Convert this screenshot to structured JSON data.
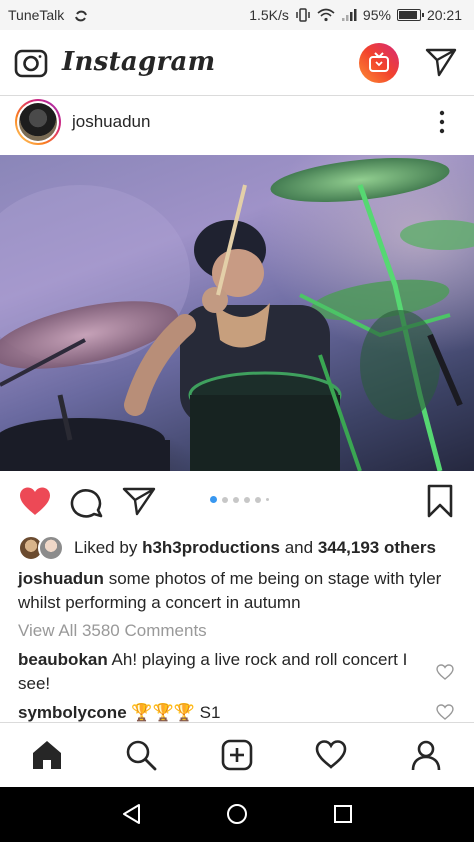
{
  "status_bar": {
    "carrier": "TuneTalk",
    "speed": "1.5K/s",
    "battery": "95%",
    "time": "20:21"
  },
  "header": {
    "logo": "Instagram",
    "icons": [
      "camera-icon",
      "igtv-icon",
      "direct-send-icon"
    ]
  },
  "post": {
    "username": "joshuadun",
    "image_alt": "drummer-on-stage-photo",
    "carousel": {
      "count": 6,
      "active_index": 0
    },
    "liked_by_prefix": "Liked by",
    "liked_by_user": "h3h3productions",
    "liked_by_and": "and",
    "others": "344,193 others",
    "caption_user": "joshuadun",
    "caption_text": "some photos of me being on stage with tyler whilst performing a concert in autumn",
    "view_all": "View All 3580 Comments",
    "comments": [
      {
        "user": "beaubokan",
        "text": "Ah! playing a live rock and roll concert I see!"
      },
      {
        "user": "symbolycone",
        "text": "🏆🏆🏆 S1"
      }
    ]
  },
  "nav": {
    "items": [
      "home-icon",
      "search-icon",
      "add-post-icon",
      "activity-heart-icon",
      "profile-icon"
    ]
  },
  "colors": {
    "like_red": "#ed4956",
    "active_dot": "#3897f0",
    "muted": "#999999"
  }
}
